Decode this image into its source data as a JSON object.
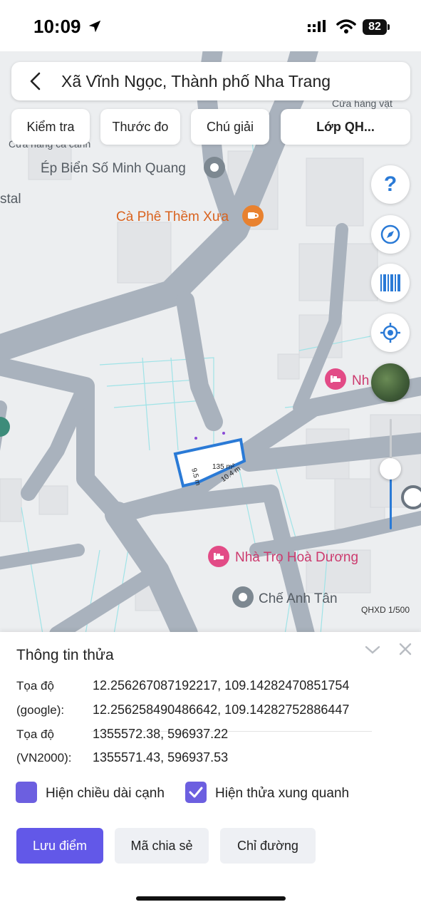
{
  "status_bar": {
    "time": "10:09",
    "battery": "82",
    "icons": [
      "location-arrow-icon",
      "cellular-signal-icon",
      "wifi-icon",
      "battery-icon"
    ]
  },
  "header": {
    "title": "Xã Vĩnh Ngọc, Thành phố Nha Trang",
    "back_icon": "chevron-left-icon"
  },
  "tabs": [
    {
      "label": "Kiểm tra"
    },
    {
      "label": "Thước đo"
    },
    {
      "label": "Chú giải"
    },
    {
      "label": "Lớp QH..."
    }
  ],
  "map": {
    "pois": [
      {
        "name": "Ép Biển Số Minh Quang",
        "icon": "pin-icon"
      },
      {
        "name": "Cà Phê Thềm Xưa",
        "icon": "coffee-icon"
      },
      {
        "name": "Nhà Trọ Hoà Dương",
        "icon": "bed-icon"
      },
      {
        "name": "Chế Anh Tân",
        "icon": "pin-icon"
      },
      {
        "name": "Nh",
        "icon": "bed-icon"
      }
    ],
    "partial_labels": {
      "stal": "stal",
      "cua_hang_ca_canh": "Cửa hàng cá cảnh",
      "cua_hang_vat": "Cửa hàng vật"
    },
    "parcel": {
      "area": "135 m²",
      "edge_1": "9.5 m",
      "edge_2": "10.4 m"
    },
    "scale": "QHXD 1/500",
    "controls": [
      "help-icon",
      "compass-icon",
      "barcode-icon",
      "locate-icon",
      "satellite-layer-icon"
    ],
    "zoom_level_fraction": 0.54,
    "colors": {
      "road": "#a9b2bd",
      "parcel_outline": "#2a7ad6",
      "accent": "#6258e8"
    }
  },
  "sheet": {
    "title": "Thông tin thửa",
    "rows": [
      {
        "label": "Tọa độ",
        "value": "12.256267087192217, 109.14282470851754"
      },
      {
        "label": "(google):",
        "value": "12.256258490486642, 109.14282752886447"
      },
      {
        "label": "Tọa độ",
        "value": "1355572.38, 596937.22"
      },
      {
        "label": "(VN2000):",
        "value": "1355571.43, 596937.53"
      }
    ],
    "checkbox_edge": {
      "label": "Hiện chiều dài cạnh",
      "checked": true
    },
    "checkbox_neighbors": {
      "label": "Hiện thửa xung quanh",
      "checked": true
    },
    "buttons": {
      "save": "Lưu điểm",
      "share_code": "Mã chia sẻ",
      "directions": "Chỉ đường"
    }
  }
}
